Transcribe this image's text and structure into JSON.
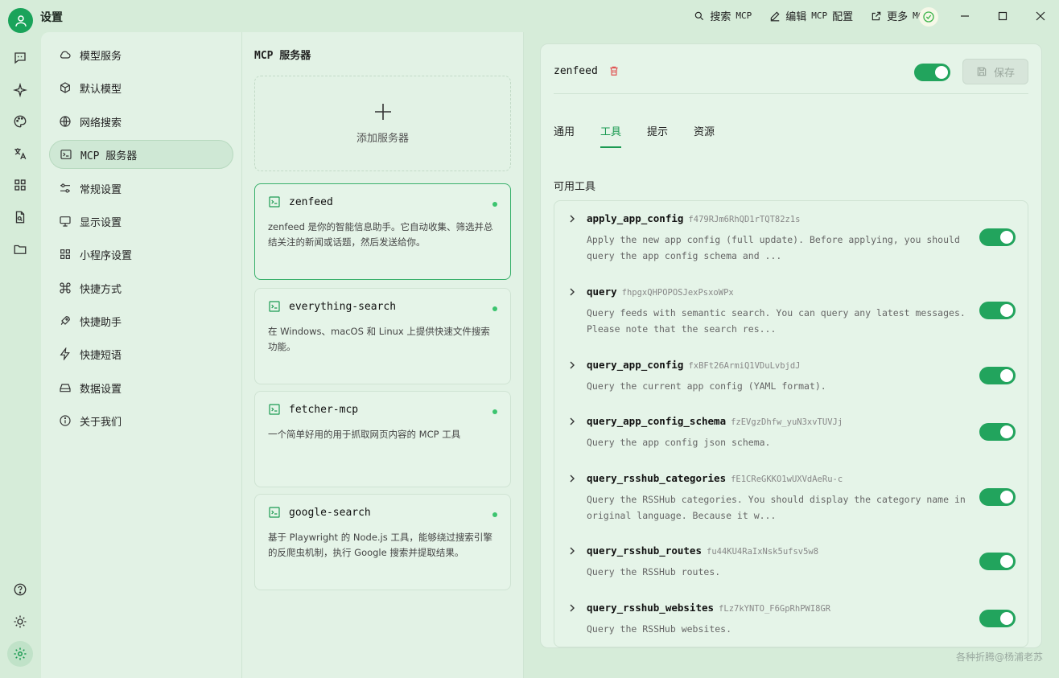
{
  "app": {
    "title": "设置"
  },
  "topbar": {
    "search_mcp": "搜索",
    "edit_mcp": "编辑",
    "edit_config": "配置",
    "more_mcp": "更多",
    "mcp": "MCP"
  },
  "nav": {
    "items": [
      {
        "label": "模型服务",
        "icon": "cloud-icon"
      },
      {
        "label": "默认模型",
        "icon": "cube-icon"
      },
      {
        "label": "网络搜索",
        "icon": "globe-icon"
      },
      {
        "label": "MCP 服务器",
        "icon": "terminal-icon"
      },
      {
        "label": "常规设置",
        "icon": "sliders-icon"
      },
      {
        "label": "显示设置",
        "icon": "monitor-icon"
      },
      {
        "label": "小程序设置",
        "icon": "grid-icon"
      },
      {
        "label": "快捷方式",
        "icon": "command-icon"
      },
      {
        "label": "快捷助手",
        "icon": "rocket-icon"
      },
      {
        "label": "快捷短语",
        "icon": "zap-icon"
      },
      {
        "label": "数据设置",
        "icon": "hard-drive-icon"
      },
      {
        "label": "关于我们",
        "icon": "info-icon"
      }
    ]
  },
  "mid": {
    "title": "MCP 服务器",
    "add_label": "添加服务器",
    "servers": [
      {
        "name": "zenfeed",
        "desc": "zenfeed 是你的智能信息助手。它自动收集、筛选并总结关注的新闻或话题，然后发送给你。"
      },
      {
        "name": "everything-search",
        "desc": "在 Windows、macOS 和 Linux 上提供快速文件搜索功能。"
      },
      {
        "name": "fetcher-mcp",
        "desc": "一个简单好用的用于抓取网页内容的 MCP 工具"
      },
      {
        "name": "google-search",
        "desc": "基于 Playwright 的 Node.js 工具，能够绕过搜索引擎的反爬虫机制，执行 Google 搜索并提取结果。"
      }
    ]
  },
  "detail": {
    "server_name": "zenfeed",
    "save_label": "保存",
    "tabs": [
      "通用",
      "工具",
      "提示",
      "资源"
    ],
    "section_label": "可用工具",
    "tools": [
      {
        "name": "apply_app_config",
        "id": "f479RJm6RhQD1rTQT82z1s",
        "desc": "Apply the new app config (full update). Before applying, you should query the app config schema and ..."
      },
      {
        "name": "query",
        "id": "fhpgxQHPOPOSJexPsxoWPx",
        "desc": "Query feeds with semantic search. You can query any latest messages. Please note that the search res..."
      },
      {
        "name": "query_app_config",
        "id": "fxBFt26ArmiQ1VDuLvbjdJ",
        "desc": "Query the current app config (YAML format)."
      },
      {
        "name": "query_app_config_schema",
        "id": "fzEVgzDhfw_yuN3xvTUVJj",
        "desc": "Query the app config json schema."
      },
      {
        "name": "query_rsshub_categories",
        "id": "fE1CReGKKO1wUXVdAeRu-c",
        "desc": "Query the RSSHub categories. You should display the category name in original language. Because it w..."
      },
      {
        "name": "query_rsshub_routes",
        "id": "fu44KU4RaIxNsk5ufsv5w8",
        "desc": "Query the RSSHub routes."
      },
      {
        "name": "query_rsshub_websites",
        "id": "fLz7kYNTO_F6GpRhPWI8GR",
        "desc": "Query the RSSHub websites."
      }
    ]
  },
  "watermark": "各种折腾@杨浦老苏",
  "colors": {
    "accent": "#22a45d",
    "background": "#d6ecd9",
    "panel": "#e2f2e5"
  }
}
